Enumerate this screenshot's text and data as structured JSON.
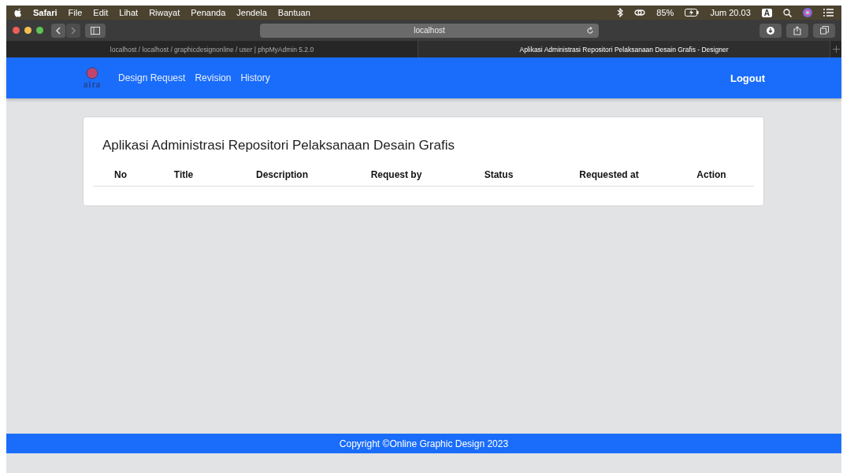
{
  "menu_bar": {
    "app": "Safari",
    "items": [
      "File",
      "Edit",
      "Lihat",
      "Riwayat",
      "Penanda",
      "Jendela",
      "Bantuan"
    ],
    "battery": "85%",
    "clock": "Jum 20.03",
    "input_source": "A"
  },
  "address_bar": {
    "value": "localhost"
  },
  "tabs": [
    {
      "label": "localhost / localhost / graphicdesignonline / user | phpMyAdmin 5.2.0",
      "selected": false
    },
    {
      "label": "Aplikasi Administrasi Repositori Pelaksanaan Desain Grafis - Designer",
      "selected": true
    }
  ],
  "navbar": {
    "logo": "aira",
    "links": [
      "Design Request",
      "Revision",
      "History"
    ],
    "logout": "Logout"
  },
  "card": {
    "title": "Aplikasi Administrasi Repositori Pelaksanaan Desain Grafis",
    "columns": [
      "No",
      "Title",
      "Description",
      "Request by",
      "Status",
      "Requested at",
      "Action"
    ]
  },
  "footer": "Copyright ©Online Graphic Design 2023"
}
